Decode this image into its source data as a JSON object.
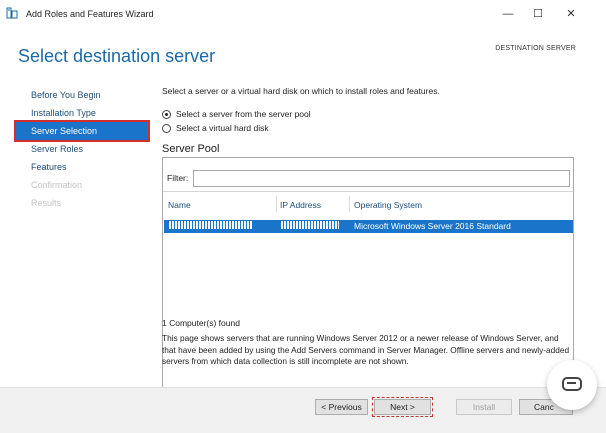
{
  "window": {
    "title": "Add Roles and Features Wizard",
    "minimize_glyph": "—",
    "maximize_glyph": "☐",
    "close_glyph": "✕"
  },
  "header": {
    "page_title": "Select destination server",
    "destination_label": "DESTINATION SERVER"
  },
  "nav": {
    "items": [
      {
        "label": "Before You Begin",
        "state": "normal"
      },
      {
        "label": "Installation Type",
        "state": "normal"
      },
      {
        "label": "Server Selection",
        "state": "active"
      },
      {
        "label": "Server Roles",
        "state": "normal"
      },
      {
        "label": "Features",
        "state": "normal"
      },
      {
        "label": "Confirmation",
        "state": "disabled"
      },
      {
        "label": "Results",
        "state": "disabled"
      }
    ]
  },
  "content": {
    "intro": "Select a server or a virtual hard disk on which to install roles and features.",
    "option_pool": "Select a server from the server pool",
    "option_vhd": "Select a virtual hard disk",
    "pool_title": "Server Pool",
    "filter_label": "Filter:",
    "filter_value": "",
    "columns": {
      "name": "Name",
      "ip": "IP Address",
      "os": "Operating System"
    },
    "rows": [
      {
        "name": "",
        "ip": "",
        "os": "Microsoft Windows Server 2016 Standard"
      }
    ],
    "count": "1 Computer(s) found",
    "note": "This page shows servers that are running Windows Server 2012 or a newer release of Windows Server, and that have been added by using the Add Servers command in Server Manager. Offline servers and newly-added servers from which data collection is still incomplete are not shown."
  },
  "footer": {
    "previous": "< Previous",
    "next": "Next >",
    "install": "Install",
    "cancel": "Canc"
  },
  "colors": {
    "accent": "#1a74c9",
    "title_blue": "#1b6aa5",
    "highlight_red": "#d32f2f"
  }
}
